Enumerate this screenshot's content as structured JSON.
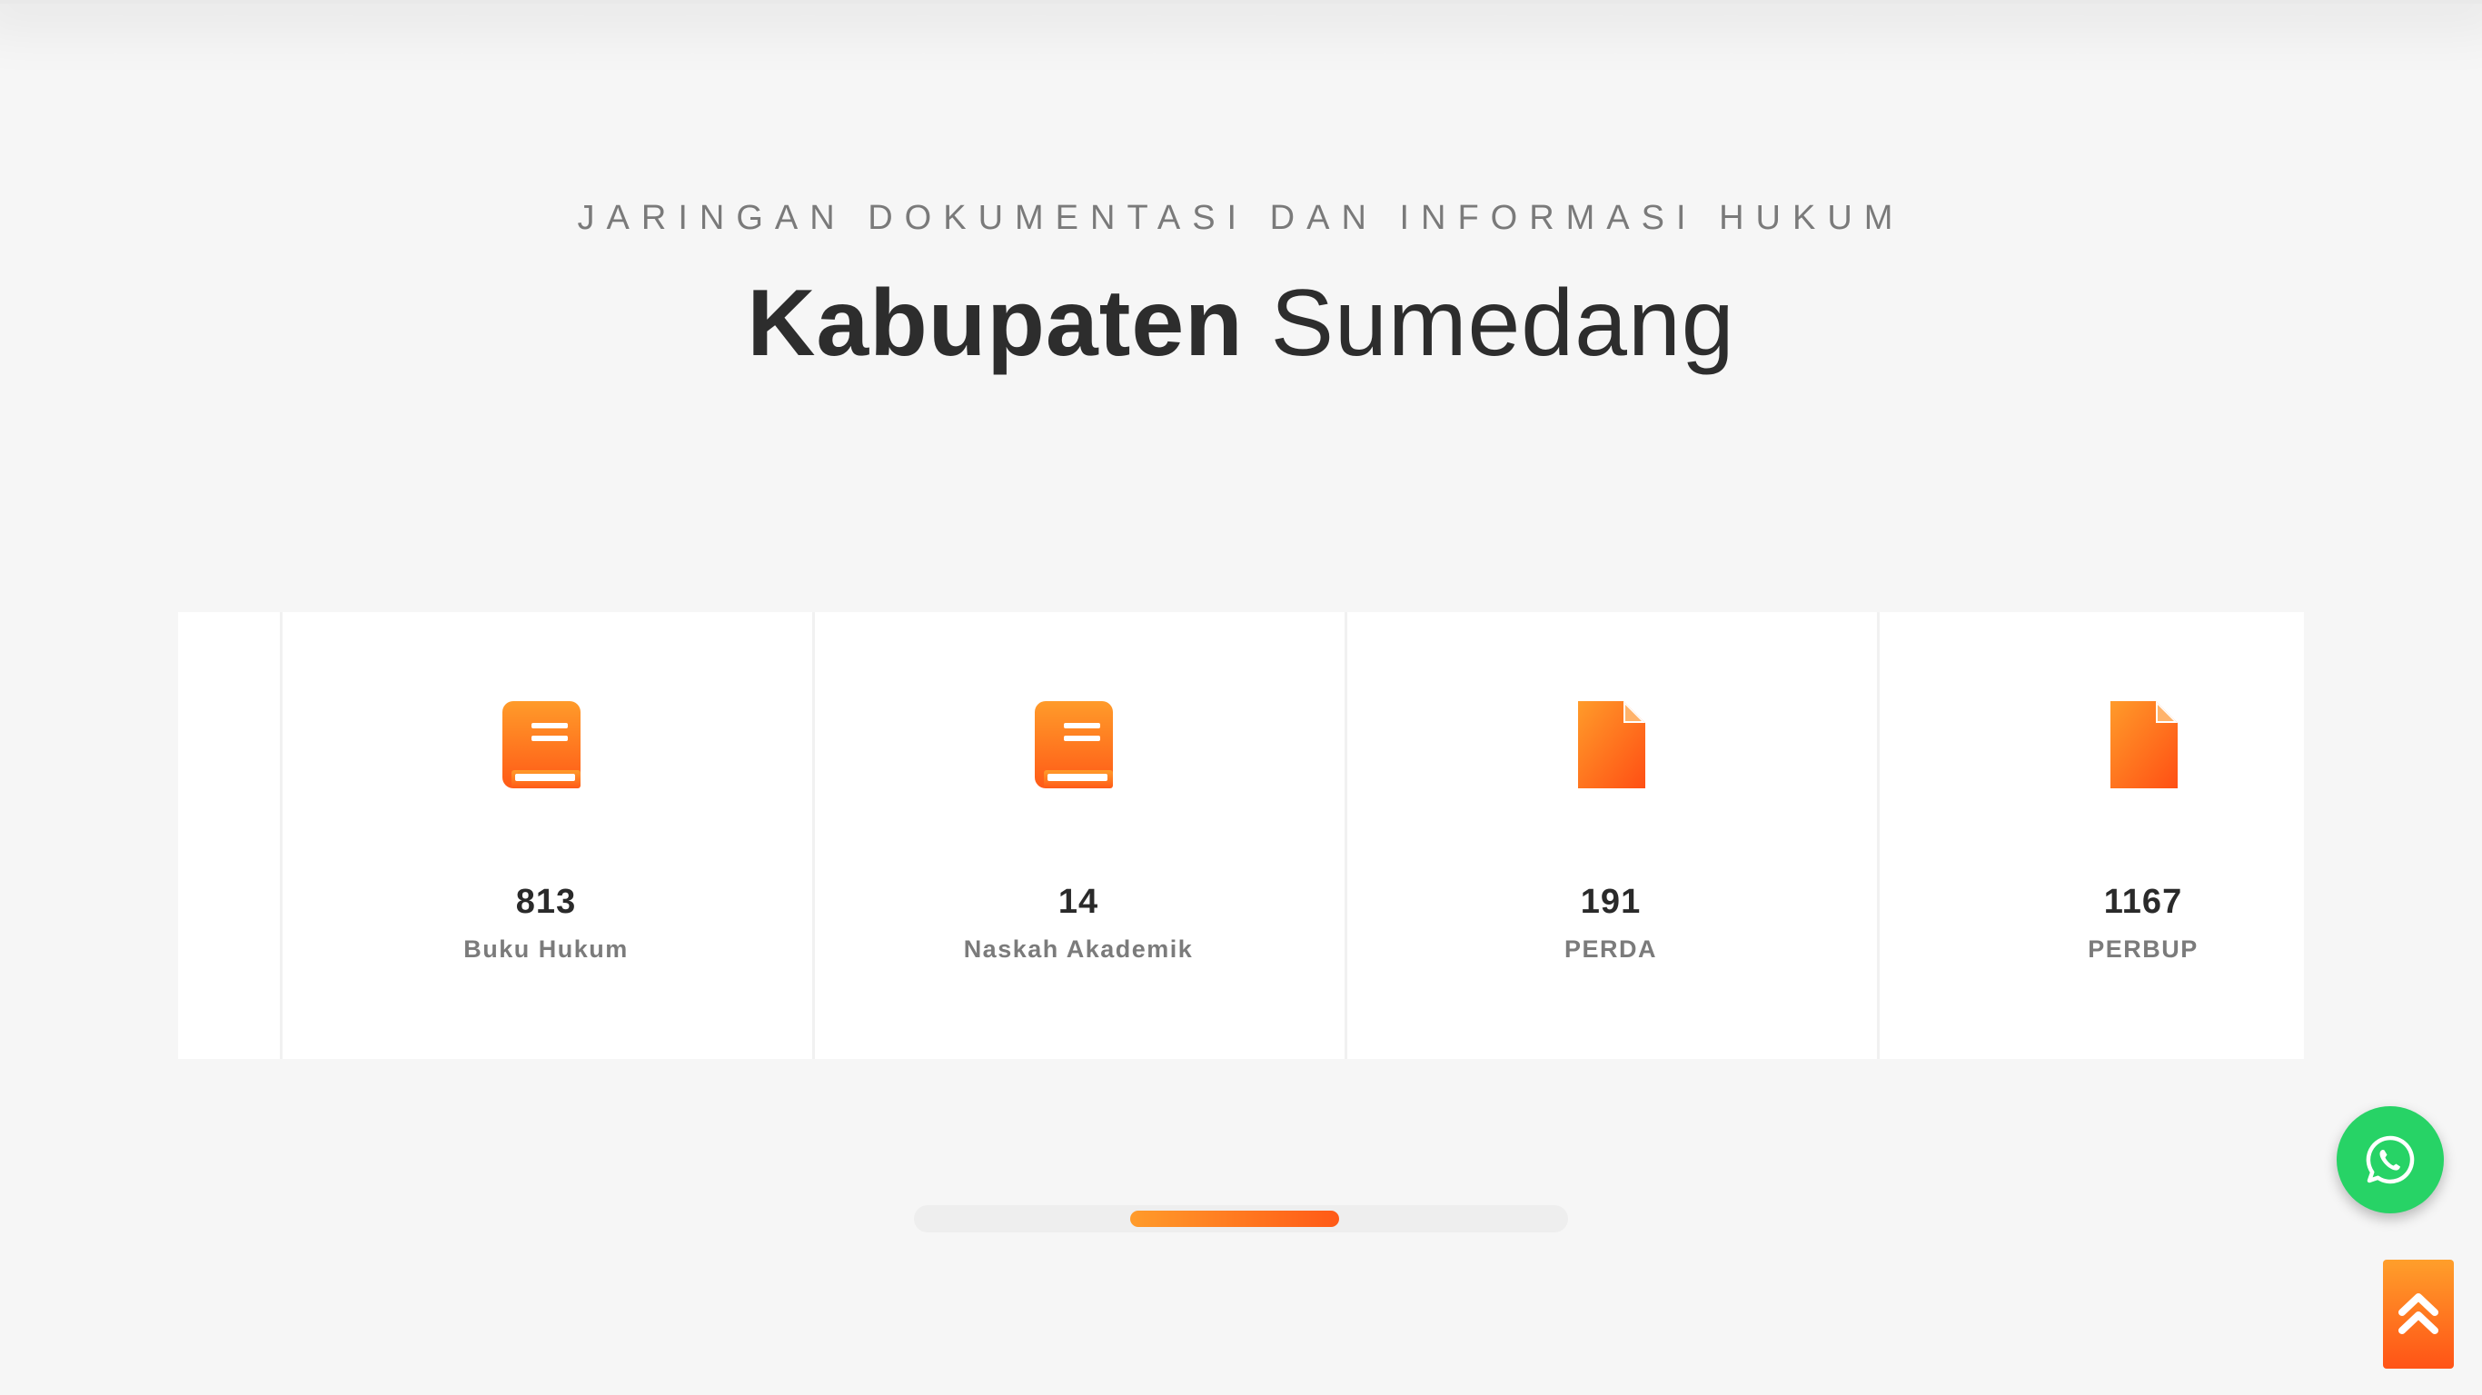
{
  "header": {
    "subtitle": "JARINGAN DOKUMENTASI DAN INFORMASI HUKUM",
    "title_bold": "Kabupaten",
    "title_light": "Sumedang"
  },
  "stats": [
    {
      "value": "813",
      "label": "Buku Hukum",
      "icon": "book-icon"
    },
    {
      "value": "14",
      "label": "Naskah Akademik",
      "icon": "book-icon"
    },
    {
      "value": "191",
      "label": "PERDA",
      "icon": "document-icon"
    },
    {
      "value": "1167",
      "label": "PERBUP",
      "icon": "document-icon"
    }
  ],
  "carousel": {
    "scroll_position_fraction": 0.33,
    "thumb_fraction": 0.32
  },
  "floating": {
    "whatsapp_icon": "whatsapp-icon",
    "back_to_top_icon": "double-chevron-up-icon"
  },
  "colors": {
    "accent_start": "#ff9b2a",
    "accent_end": "#ff5a17",
    "whatsapp": "#27d366",
    "background": "#f6f6f6"
  }
}
